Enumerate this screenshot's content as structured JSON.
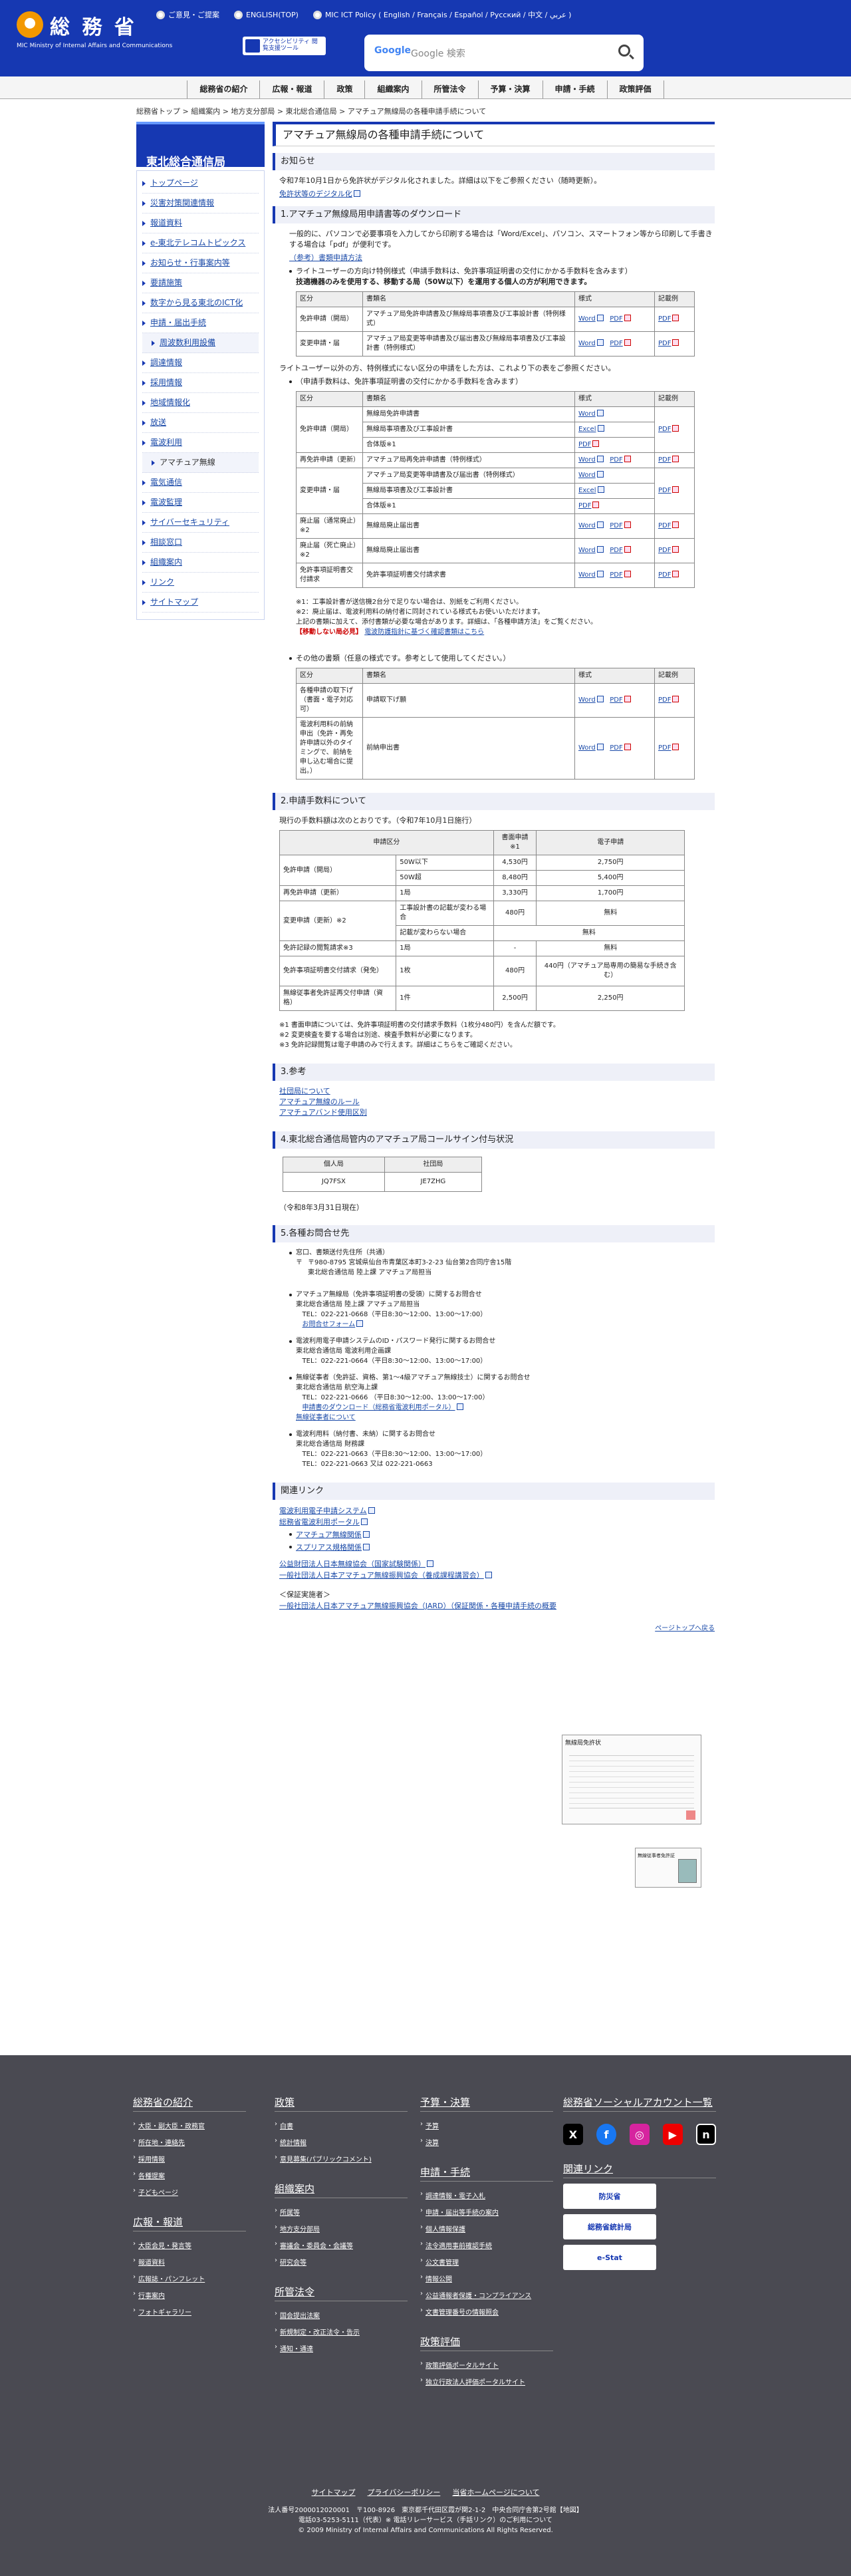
{
  "header": {
    "logo_name": "総 務 省",
    "logo_sub": "MIC Ministry of Internal Affairs and Communications",
    "lang_links": [
      "ご意見・ご提案",
      "ENGLISH(TOP)",
      "MIC ICT Policy ( English / Français / Español / Русский / 中文 / عربي )"
    ],
    "a11y_label": "アクセシビリティ 閲覧支援ツール",
    "search_placeholder": "Google 検索",
    "google_label": "Google"
  },
  "gnav": [
    "総務省の紹介",
    "広報・報道",
    "政策",
    "組織案内",
    "所管法令",
    "予算・決算",
    "申請・手続",
    "政策評価"
  ],
  "breadcrumb": "総務省トップ > 組織案内 > 地方支分部局 > 東北総合通信局 > アマチュア無線局の各種申請手続について",
  "sidebar": {
    "title": "東北総合通信局",
    "items": [
      {
        "label": "トップページ"
      },
      {
        "label": "災害対策関連情報"
      },
      {
        "label": "報道資料"
      },
      {
        "label": "e-東北テレコムトピックス"
      },
      {
        "label": "お知らせ・行事案内等"
      },
      {
        "label": "要請施策"
      },
      {
        "label": "数字から見る東北のICT化"
      },
      {
        "label": "申請・届出手続"
      },
      {
        "label": "周波数利用設備",
        "sub": true
      },
      {
        "label": "調達情報"
      },
      {
        "label": "採用情報"
      },
      {
        "label": "地域情報化"
      },
      {
        "label": "放送"
      },
      {
        "label": "電波利用"
      },
      {
        "label": "アマチュア無線",
        "sub": true,
        "current": true
      },
      {
        "label": "電気通信"
      },
      {
        "label": "電波監理"
      },
      {
        "label": "サイバーセキュリティ"
      },
      {
        "label": "相談窓口"
      },
      {
        "label": "組織案内"
      },
      {
        "label": "リンク"
      },
      {
        "label": "サイトマップ"
      }
    ]
  },
  "main": {
    "page_title": "アマチュア無線局の各種申請手続について",
    "notice_h": "お知らせ",
    "notice_text": "令和7年10月1日から免許状がデジタル化されました。詳細は以下をご参照ください（随時更新）。",
    "notice_link": "免許状等のデジタル化",
    "s1_h": "1.アマチュア無線局用申請書等のダウンロード",
    "s1_p1": "一般的に、パソコンで必要事項を入力してから印刷する場合は「Word/Excel」、パソコン、スマートフォン等から印刷して手書きする場合は「pdf」が便利です。",
    "s1_ref": "（参考）書類申請方法",
    "s1_b1": "ライトユーザーの方向け特例様式（申請手数料は、免許事項証明書の交付にかかる手数料を含みます）",
    "s1_b1b": "技適機器のみを使用する、移動する局（50W以下）を運用する個人の方が利用できます。",
    "th": [
      "区分",
      "書類名",
      "様式",
      "記載例"
    ],
    "t1": [
      [
        "免許申請（開局）",
        "アマチュア局免許申請書及び無線局事項書及び工事設計書（特例様式）"
      ],
      [
        "変更申請・届",
        "アマチュア局変更等申請書及び届出書及び無線局事項書及び工事設計書（特例様式）"
      ]
    ],
    "word": "Word",
    "excel": "Excel",
    "pdf": "PDF",
    "s1_p2": "ライトユーザー以外の方、特例様式にない区分の申請をした方は、これより下の表をご参照ください。",
    "s1_b2": "（申請手数料は、免許事項証明書の交付にかかる手数料を含みます）",
    "t2": [
      {
        "k": "免許申請（開局）",
        "docs": [
          "無線局免許申請書",
          "無線局事項書及び工事設計書",
          "合体版※1"
        ]
      },
      {
        "k": "再免許申請（更新）",
        "docs": [
          "アマチュア局再免許申請書（特例様式）"
        ]
      },
      {
        "k": "変更申請・届",
        "docs": [
          "アマチュア局変更等申請書及び届出書（特例様式）",
          "無線局事項書及び工事設計書",
          "合体版※1"
        ]
      },
      {
        "k": "廃止届（通常廃止）※2",
        "docs": [
          "無線局廃止届出書"
        ]
      },
      {
        "k": "廃止届（死亡廃止）※2",
        "docs": [
          "無線局廃止届出書"
        ]
      },
      {
        "k": "免許事項証明書交付請求",
        "docs": [
          "免許事項証明書交付請求書"
        ]
      }
    ],
    "note1": "※1：工事設計書が送信機2台分で足りない場合は、別紙をご利用ください。",
    "note2": "※2：廃止届は、電波利用料の納付者に同封されている様式もお使いいただけます。",
    "note3": "上記の書類に加えて、添付書類が必要な場合があります。詳細は、「各種申請方法」をご覧ください。",
    "note4_red": "【移動しない局必見】",
    "note4": "電波防護指針に基づく確認書類はこちら",
    "s1_b3": "その他の書類（任意の様式です。参考として使用してください。）",
    "t3": [
      [
        "各種申請の取下げ（書面・電子対応可）",
        "申請取下げ願"
      ],
      [
        "電波利用料の前納申出（免許・再免許申請以外のタイミングで、前納を申し込む場合に提出。）",
        "前納申出書"
      ]
    ],
    "s2_h": "2.申請手数料について",
    "s2_p": "現行の手数料額は次のとおりです。（令和7年10月1日施行）",
    "fee_th": [
      "申請区分",
      "",
      "書面申請※1",
      "電子申請"
    ],
    "fees": [
      [
        "免許申請（開局）",
        "50W以下",
        "4,530円",
        "2,750円"
      ],
      [
        "",
        "50W超",
        "8,480円",
        "5,400円"
      ],
      [
        "再免許申請（更新）",
        "1局",
        "3,330円",
        "1,700円"
      ],
      [
        "変更申請（更新）※2",
        "工事設計書の記載が変わる場合",
        "480円",
        "無料"
      ],
      [
        "",
        "記載が変わらない場合",
        "無料",
        ""
      ],
      [
        "免許記録の閲覧請求※3",
        "1局",
        "-",
        "無料"
      ],
      [
        "免許事項証明書交付請求（発免）",
        "1枚",
        "480円",
        "440円（アマチュア局専用の簡易な手続き含む）"
      ],
      [
        "無線従事者免許証再交付申請（資格）",
        "1件",
        "2,500円",
        "2,250円"
      ]
    ],
    "fee_n1": "※1 書面申請については、免許事項証明書の交付請求手数料（1枚分480円）を含んだ額です。",
    "fee_n2": "※2 変更検査を要する場合は別途、検査手数料が必要になります。",
    "fee_n3": "※3 免許記録閲覧は電子申請のみで行えます。詳細はこちらをご確認ください。",
    "s3_h": "3.参考",
    "s3_links": [
      "社団局について",
      "アマチュア無線のルール",
      "アマチュアバンド使用区別"
    ],
    "s4_h": "4.東北総合通信局管内のアマチュア局コールサイン付与状況",
    "cs_th": [
      "個人局",
      "社団局"
    ],
    "cs": [
      "JQ7FSX",
      "JE7ZHG"
    ],
    "cs_date": "（令和8年3月31日現在）",
    "s5_h": "5.各種お問合せ先",
    "addr": [
      "窓口、書類送付先住所（共通）",
      "〒980-8795 宮城県仙台市青葉区本町3-2-23 仙台第2合同庁舎15階",
      "東北総合通信局 陸上課 アマチュア局担当"
    ],
    "contacts": [
      [
        "アマチュア無線局（免許事項証明書の受領）に関するお問合せ",
        "東北総合通信局 陸上課 アマチュア局担当",
        "TEL：022-221-0668（平日8:30～12:00、13:00～17:00）",
        "お問合せフォーム"
      ],
      [
        "電波利用電子申請システムのID・パスワード発行に関するお問合せ",
        "東北総合通信局 電波利用企画課",
        "TEL：022-221-0664（平日8:30～12:00、13:00～17:00）",
        ""
      ],
      [
        "無線従事者（免許証、資格、第1～4級アマチュア無線技士）に関するお問合せ",
        "東北総合通信局 航空海上課",
        "TEL：022-221-0666 （平日8:30～12:00、13:00～17:00）",
        "申請書のダウンロード（総務省電波利用ポータル）"
      ],
      [
        "電波利用料（納付書、未納）に関するお問合せ",
        "東北総合通信局 財務課",
        "TEL：022-221-0663（平日8:30～12:00、13:00～17:00）",
        ""
      ]
    ],
    "exam_link": "無線従事者について",
    "tel_extra": "TEL：022-221-0663 又は 022-221-0663",
    "rel_h": "関連リンク",
    "rel": [
      "電波利用電子申請システム",
      "総務省電波利用ポータル",
      "アマチュア無線関係",
      "スプリアス規格関係"
    ],
    "rel2": [
      "公益財団法人日本無線協会（国家試験関係）",
      "一般社団法人日本アマチュア無線振興協会（養成課程講習会）"
    ],
    "rel3_t": "＜保証実施者＞",
    "rel3": "一般社団法人日本アマチュア無線振興協会（JARD）（保証関係・各種申請手続の概要",
    "pagetop": "ページトップへ戻る",
    "lic_label": "無線局免許状",
    "card_label": "無線従事者免許証"
  },
  "footer": {
    "col1": {
      "h": "総務省の紹介",
      "items": [
        "大臣・副大臣・政務官",
        "所在地・連絡先",
        "採用情報",
        "各種提案",
        "子どもページ"
      ]
    },
    "col1b": {
      "h": "広報・報道",
      "items": [
        "大臣会見・発言等",
        "報道資料",
        "広報誌・パンフレット",
        "行事案内",
        "フォトギャラリー"
      ]
    },
    "col2": {
      "h": "政策",
      "items": [
        "白書",
        "統計情報",
        "意見募集(パブリックコメント)"
      ]
    },
    "col2b": {
      "h": "組織案内",
      "items": [
        "所属等",
        "地方支分部局",
        "審議会・委員会・会議等",
        "研究会等"
      ]
    },
    "col2c": {
      "h": "所管法令",
      "items": [
        "国会提出法案",
        "新規制定・改正法令・告示",
        "通知・通達"
      ]
    },
    "col3": {
      "h": "予算・決算",
      "items": [
        "予算",
        "決算"
      ]
    },
    "col3b": {
      "h": "申請・手続",
      "items": [
        "調達情報・電子入札",
        "申請・届出等手続の案内",
        "個人情報保護",
        "法令適用事前確認手続",
        "公文書管理",
        "情報公開",
        "公益通報者保護・コンプライアンス",
        "文書管理番号の情報照会"
      ]
    },
    "col3c": {
      "h": "政策評価",
      "items": [
        "政策評価ポータルサイト",
        "独立行政法人評価ポータルサイト"
      ]
    },
    "col4": {
      "h": "総務省ソーシャルアカウント一覧",
      "rel": "関連リンク",
      "banners": [
        "防災省",
        "総務省統計局",
        "e-Stat"
      ]
    },
    "links": [
      "サイトマップ",
      "プライバシーポリシー",
      "当省ホームページについて"
    ],
    "addr": "法人番号2000012020001　〒100-8926　東京都千代田区霞が関2-1-2　中央合同庁舎第2号館【地図】",
    "tel": "電話03-5253-5111（代表）※ 電話リレーサービス（手話リンク）のご利用について",
    "copy": "© 2009 Ministry of Internal Affairs and Communications All Rights Reserved."
  }
}
